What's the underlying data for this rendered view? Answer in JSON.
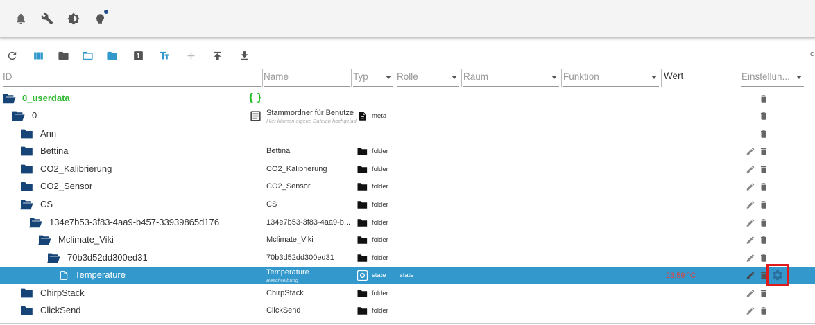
{
  "columns": {
    "id": "ID",
    "name": "Name",
    "type": "Typ",
    "role": "Rolle",
    "room": "Raum",
    "function": "Funktion",
    "value": "Wert",
    "settings": "Einstellun..."
  },
  "edge_char": "c",
  "topbar_icons": [
    "bell-icon",
    "wrench-icon",
    "brightness-icon",
    "expert-mode-icon"
  ],
  "toolbar_icons": [
    "refresh-icon",
    "columns-icon",
    "folder-icon",
    "folder-open-icon",
    "folder-icon",
    "digit-icon",
    "text-size-icon",
    "add-icon",
    "upload-icon",
    "download-icon"
  ],
  "rows": [
    {
      "id": "0_userdata",
      "name": "",
      "desc": "",
      "type": "",
      "role": "",
      "value": ""
    },
    {
      "id": "0",
      "name": "Stammordner für Benutze",
      "desc": "Hier können eigene Dateien hochgeladen",
      "type": "meta",
      "role": "",
      "value": ""
    },
    {
      "id": "Ann",
      "name": "",
      "desc": "",
      "type": "",
      "role": "",
      "value": ""
    },
    {
      "id": "Bettina",
      "name": "Bettina",
      "desc": "",
      "type": "folder",
      "role": "",
      "value": ""
    },
    {
      "id": "CO2_Kalibrierung",
      "name": "CO2_Kalibrierung",
      "desc": "",
      "type": "folder",
      "role": "",
      "value": ""
    },
    {
      "id": "CO2_Sensor",
      "name": "CO2_Sensor",
      "desc": "",
      "type": "folder",
      "role": "",
      "value": ""
    },
    {
      "id": "CS",
      "name": "CS",
      "desc": "",
      "type": "folder",
      "role": "",
      "value": ""
    },
    {
      "id": "134e7b53-3f83-4aa9-b457-33939865d176",
      "name": "134e7b53-3f83-4aa9-b...",
      "desc": "",
      "type": "folder",
      "role": "",
      "value": ""
    },
    {
      "id": "Mclimate_Viki",
      "name": "Mclimate_Viki",
      "desc": "",
      "type": "folder",
      "role": "",
      "value": ""
    },
    {
      "id": "70b3d52dd300ed31",
      "name": "70b3d52dd300ed31",
      "desc": "",
      "type": "folder",
      "role": "",
      "value": ""
    },
    {
      "id": "Temperature",
      "name": "Temperature",
      "desc": "Beschreibung",
      "type": "state",
      "role": "state",
      "value": "23.59 °C"
    },
    {
      "id": "ChirpStack",
      "name": "ChirpStack",
      "desc": "",
      "type": "folder",
      "role": "",
      "value": ""
    },
    {
      "id": "ClickSend",
      "name": "ClickSend",
      "desc": "",
      "type": "folder",
      "role": "",
      "value": ""
    }
  ],
  "json_badge": "{ }"
}
